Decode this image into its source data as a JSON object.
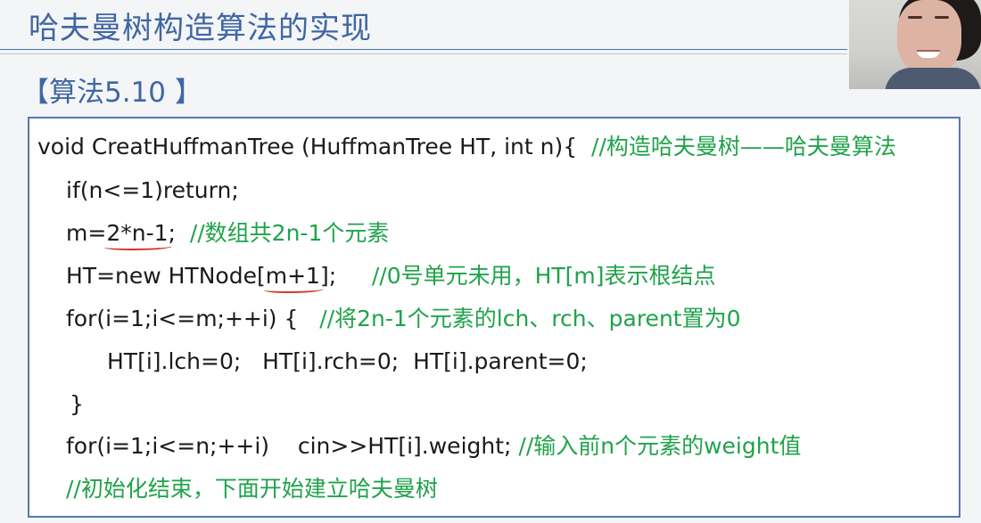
{
  "slide": {
    "title": "哈夫曼树构造算法的实现",
    "algorithm_label": "【算法5.10 】"
  },
  "code": {
    "l1_code": "void CreatHuffmanTree (HuffmanTree HT, int n){  ",
    "l1_comment": "//构造哈夫曼树——哈夫曼算法",
    "l2_code": "if(n<=1)return;",
    "l3_pre": "m=",
    "l3_mark": "2*n-1",
    "l3_post": ";  ",
    "l3_comment": "//数组共2n-1个元素",
    "l4_pre": "HT=new HTNode[",
    "l4_mark": "m+1",
    "l4_post": "];     ",
    "l4_comment": "//0号单元未用，HT[m]表示根结点",
    "l5_code": "for(i=1;i<=m;++i) {   ",
    "l5_comment": "//将2n-1个元素的lch、rch、parent置为0",
    "l6_code": "HT[i].lch=0;   HT[i].rch=0;  HT[i].parent=0;",
    "l7_code": "}",
    "l8_code": "for(i=1;i<=n;++i)    cin>>HT[i].weight; ",
    "l8_comment": "//输入前n个元素的weight值",
    "l9_comment": "//初始化结束，下面开始建立哈夫曼树"
  },
  "colors": {
    "title": "#3f67a3",
    "comment": "#1fa34a",
    "code": "#1a1a1a",
    "underline": "#d0342c",
    "box_border": "#5678b0"
  }
}
